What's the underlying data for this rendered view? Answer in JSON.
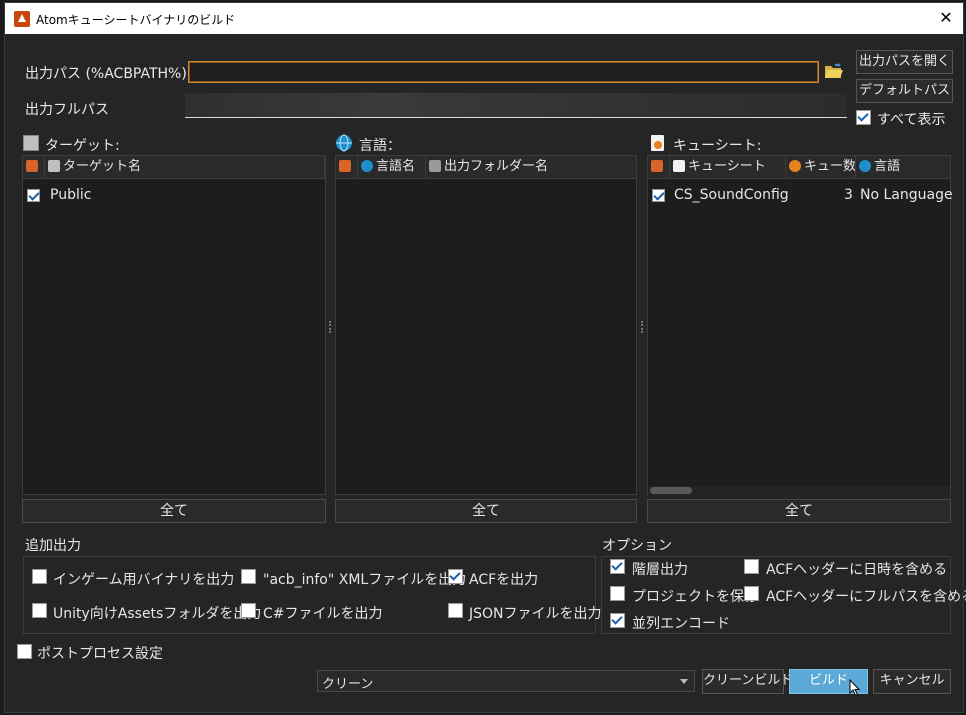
{
  "window": {
    "title": "Atomキューシートバイナリのビルド",
    "close": "✕"
  },
  "output": {
    "path_label": "出力パス (%ACBPATH%)",
    "path_value": "",
    "fullpath_label": "出力フルパス",
    "open_button": "出力パスを開く",
    "default_button": "デフォルトパス",
    "show_all_label": "すべて表示",
    "show_all_checked": true
  },
  "panels": {
    "target": {
      "title": "ターゲット:",
      "columns": [
        "",
        "ターゲット名"
      ],
      "rows": [
        {
          "checked": true,
          "name": "Public"
        }
      ],
      "all_button": "全て"
    },
    "language": {
      "title": "言語：",
      "columns": [
        "",
        "言語名",
        "出力フォルダー名"
      ],
      "rows": [],
      "all_button": "全て"
    },
    "cuesheet": {
      "title": "キューシート:",
      "columns": [
        "",
        "キューシート",
        "キュー数",
        "言語"
      ],
      "rows": [
        {
          "checked": true,
          "name": "CS_SoundConfig",
          "count": "3",
          "language": "No Language"
        }
      ],
      "all_button": "全て"
    }
  },
  "additional": {
    "title": "追加出力",
    "items": [
      {
        "label": "インゲーム用バイナリを出力",
        "checked": false
      },
      {
        "label": "\"acb_info\" XMLファイルを出力",
        "checked": false
      },
      {
        "label": "ACFを出力",
        "checked": true
      },
      {
        "label": "Unity向けAssetsフォルダを出力",
        "checked": false
      },
      {
        "label": "C#ファイルを出力",
        "checked": false
      },
      {
        "label": "JSONファイルを出力",
        "checked": false
      }
    ]
  },
  "options": {
    "title": "オプション",
    "items": [
      {
        "label": "階層出力",
        "checked": true
      },
      {
        "label": "ACFヘッダーに日時を含める",
        "checked": false
      },
      {
        "label": "プロジェクトを保存",
        "checked": false
      },
      {
        "label": "ACFヘッダーにフルパスを含める",
        "checked": false
      },
      {
        "label": "並列エンコード",
        "checked": true
      }
    ]
  },
  "postprocess": {
    "label": "ポストプロセス設定",
    "checked": false
  },
  "footer": {
    "mode_select": "クリーン",
    "clean_build": "クリーンビルド",
    "build": "ビルド",
    "cancel": "キャンセル"
  },
  "colors": {
    "accent": "#d08a2a",
    "build_button": "#5aa9d6"
  }
}
